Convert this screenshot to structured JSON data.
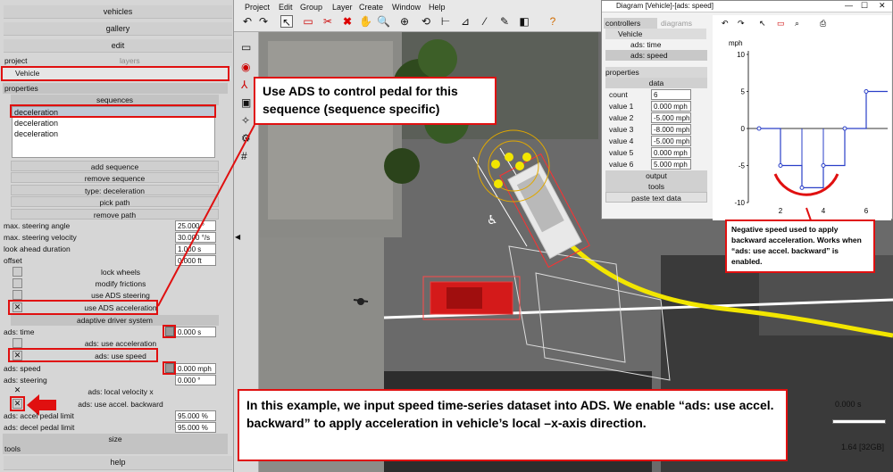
{
  "left_panel": {
    "nav": {
      "vehicles": "vehicles",
      "gallery": "gallery",
      "edit": "edit"
    },
    "tabs": {
      "project": "project",
      "layers": "layers"
    },
    "vehicle_name": "Vehicle",
    "properties_label": "properties",
    "sequences": {
      "header": "sequences",
      "selected": "deceleration",
      "items": [
        "deceleration",
        "deceleration"
      ],
      "add": "add sequence",
      "remove": "remove sequence",
      "type": "type: deceleration",
      "pick_path": "pick path",
      "remove_path": "remove path"
    },
    "fields": [
      {
        "label": "max. steering angle",
        "value": "25.000 °"
      },
      {
        "label": "max. steering velocity",
        "value": "30.000 °/s"
      },
      {
        "label": "look ahead duration",
        "value": "1.000 s"
      },
      {
        "label": "offset",
        "value": "0.000 ft"
      }
    ],
    "checks": {
      "lock_wheels": "lock wheels",
      "modify_frictions": "modify frictions",
      "use_ads_steering": "use ADS steering",
      "use_ads_acceleration": "use ADS acceleration"
    },
    "ads_header": "adaptive driver system",
    "ads": {
      "time_label": "ads: time",
      "time_value": "0.000 s",
      "use_accel": "ads: use acceleration",
      "use_speed": "ads: use speed",
      "speed_label": "ads: speed",
      "speed_value": "0.000 mph",
      "steering_label": "ads: steering",
      "steering_value": "0.000 °",
      "local_vel": "ads: local velocity x",
      "accel_back": "ads: use accel. backward",
      "accel_pedal_label": "ads: accel pedal limit",
      "accel_pedal_value": "95.000 %",
      "decel_pedal_label": "ads: decel pedal limit",
      "decel_pedal_value": "95.000 %"
    },
    "size": "size",
    "tools": "tools",
    "help": "help"
  },
  "menubar": [
    "Project",
    "Edit",
    "Group",
    "Layer",
    "Create",
    "Window",
    "Help"
  ],
  "diagram": {
    "title": "Diagram [Vehicle]-[ads: speed]",
    "tabs": {
      "controllers": "controllers",
      "diagrams": "diagrams"
    },
    "tree_vehicle": "Vehicle",
    "tree_time": "ads: time",
    "tree_speed": "ads: speed",
    "properties": "properties",
    "data_header": "data",
    "count_label": "count",
    "count_value": "6",
    "values": [
      {
        "label": "value 1",
        "value": "0.000 mph"
      },
      {
        "label": "value 2",
        "value": "-5.000 mph"
      },
      {
        "label": "value 3",
        "value": "-8.000 mph"
      },
      {
        "label": "value 4",
        "value": "-5.000 mph"
      },
      {
        "label": "value 5",
        "value": "0.000 mph"
      },
      {
        "label": "value 6",
        "value": "5.000 mph"
      }
    ],
    "output": "output",
    "tools": "tools",
    "paste": "paste text data",
    "chart_unit": "mph",
    "y_ticks": [
      "10",
      "5",
      "0",
      "-5",
      "-10"
    ],
    "x_ticks": [
      "2",
      "4",
      "6"
    ]
  },
  "chart_data": {
    "type": "line",
    "x": [
      1,
      2,
      3,
      4,
      5,
      6
    ],
    "series": [
      {
        "values": [
          0,
          -5,
          -8,
          -5,
          0,
          5
        ]
      }
    ],
    "ylabel": "mph",
    "ylim": [
      -10,
      10
    ]
  },
  "callouts": {
    "pedal": "Use ADS to control pedal for this sequence (sequence specific)",
    "negative": "Negative speed used to apply backward acceleration. Works when “ads: use accel. backward” is enabled.",
    "example": "In this example, we input speed time-series dataset into ADS. We enable “ads: use accel. backward” to apply acceleration in vehicle’s local –x-axis direction."
  },
  "status": {
    "time": "0.000 s",
    "memory": "1.64 [32GB]"
  },
  "colors": {
    "annotation": "#e01010",
    "path": "#f2e600",
    "car": "#d41a1a"
  }
}
